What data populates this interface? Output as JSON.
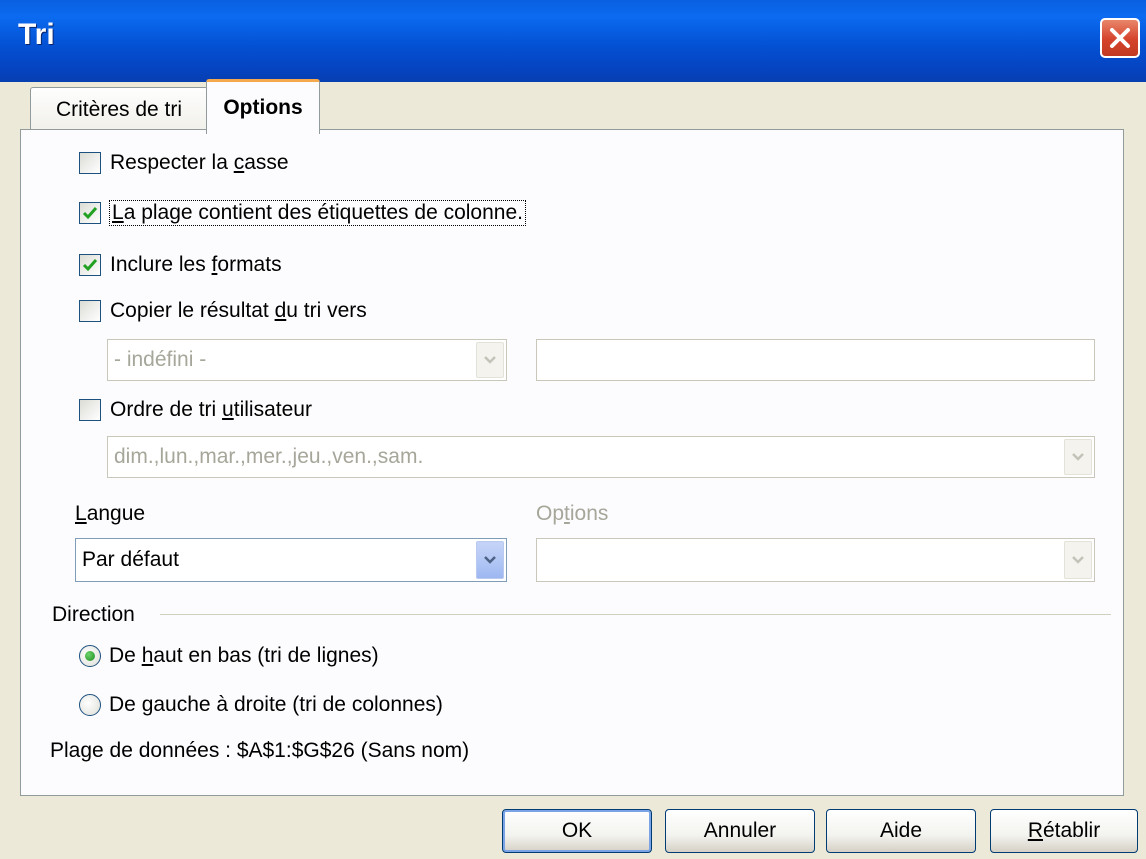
{
  "window": {
    "title": "Tri"
  },
  "tabs": [
    {
      "label": "Critères de tri",
      "active": false
    },
    {
      "label": "Options",
      "active": true
    }
  ],
  "options": {
    "case_sensitive": {
      "label": "Respecter la casse",
      "checked": false
    },
    "has_headers": {
      "label": "La plage contient des étiquettes de colonne.",
      "checked": true
    },
    "include_formats": {
      "label": "Inclure les formats",
      "checked": true
    },
    "copy_result": {
      "label": "Copier le résultat du tri vers",
      "checked": false,
      "target_select_value": "- indéfini -",
      "target_input_value": ""
    },
    "custom_order": {
      "label": "Ordre de tri utilisateur",
      "checked": false,
      "select_value": "dim.,lun.,mar.,mer.,jeu.,ven.,sam."
    },
    "language": {
      "label": "Langue",
      "value": "Par défaut"
    },
    "lang_options": {
      "label": "Options",
      "value": ""
    }
  },
  "direction": {
    "label": "Direction",
    "top_bottom": {
      "label": "De haut en bas (tri de lignes)",
      "selected": true
    },
    "left_right": {
      "label": "De gauche à droite (tri de colonnes)",
      "selected": false
    }
  },
  "data_range": "Plage de données : $A$1:$G$26 (Sans nom)",
  "buttons": {
    "ok": "OK",
    "cancel": "Annuler",
    "help": "Aide",
    "reset": "Rétablir"
  },
  "colors": {
    "titlebar": "#0451d4",
    "dialog_bg": "#ece9d8",
    "panel_bg": "#fcfcfe",
    "check_green": "#21a121",
    "tab_highlight": "#f6a84c"
  },
  "icons": {
    "close": "close-icon",
    "check": "checkmark-icon",
    "dropdown": "chevron-down-icon"
  }
}
